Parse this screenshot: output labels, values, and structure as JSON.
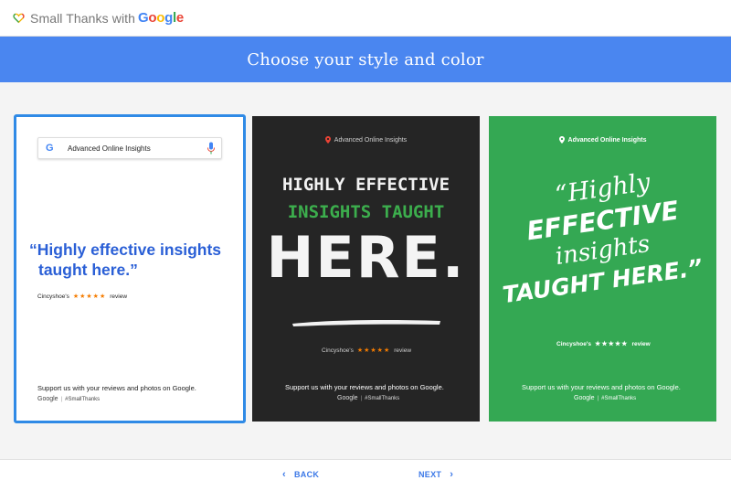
{
  "header": {
    "app_title": "Small Thanks with",
    "brand_google": "Google",
    "logo_icon": "heart-icon"
  },
  "banner": {
    "title": "Choose your style and color"
  },
  "business_name": "Advanced Online Insights",
  "cards": [
    {
      "style": "white-search",
      "quote_line1": "“Highly effective insights",
      "quote_line2": "taught here.”",
      "reviewer": "Cincyshoe's",
      "stars": "★★★★★",
      "review_word": "review",
      "support_text": "Support us with your reviews and photos on Google.",
      "footer_google": "Google",
      "footer_sep": "|",
      "hashtag": "#SmallThanks",
      "selected": true,
      "border_color": "#2f8ae6",
      "quote_color": "#2a5fd6"
    },
    {
      "style": "dark-chalk",
      "line1": "HIGHLY EFFECTIVE",
      "line2": "INSIGHTS TAUGHT",
      "line3": "HERE.",
      "reviewer": "Cincyshoe's",
      "stars": "★★★★★",
      "review_word": "review",
      "support_text": "Support us with your reviews and photos on Google.",
      "footer_google": "Google",
      "footer_sep": "|",
      "hashtag": "#SmallThanks",
      "selected": false,
      "bg_color": "#252525",
      "accent_color": "#3cae4d"
    },
    {
      "style": "green-script",
      "line1": "“Highly",
      "line2": "EFFECTIVE",
      "line3": "insights",
      "line4": "TAUGHT HERE.”",
      "reviewer": "Cincyshoe's",
      "stars": "★★★★★",
      "review_word": "review",
      "support_text": "Support us with your reviews and photos on Google.",
      "footer_google": "Google",
      "footer_sep": "|",
      "hashtag": "#SmallThanks",
      "selected": false,
      "bg_color": "#34a853"
    }
  ],
  "nav": {
    "back_label": "BACK",
    "next_label": "NEXT",
    "back_icon": "chevron-left-icon",
    "next_icon": "chevron-right-icon",
    "accent": "#3b78e7"
  }
}
